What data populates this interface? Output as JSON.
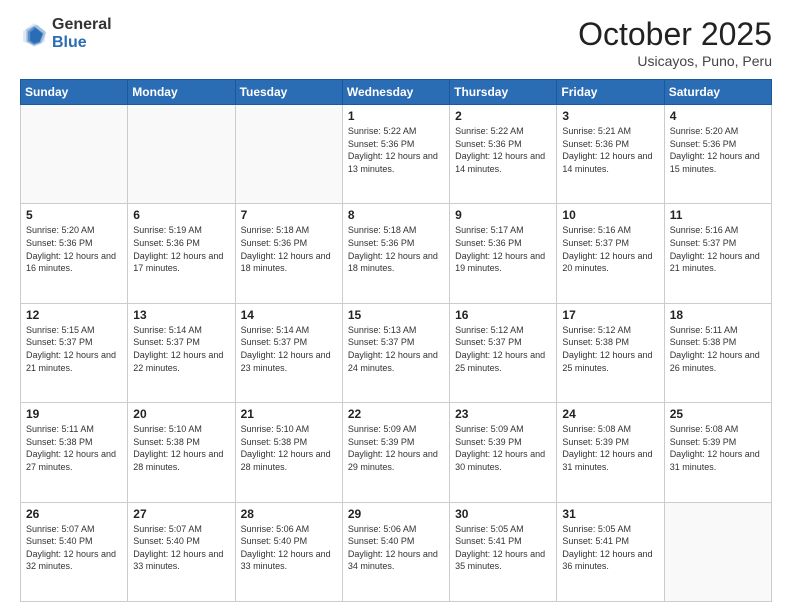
{
  "header": {
    "logo_general": "General",
    "logo_blue": "Blue",
    "title": "October 2025",
    "location": "Usicayos, Puno, Peru"
  },
  "calendar": {
    "days_of_week": [
      "Sunday",
      "Monday",
      "Tuesday",
      "Wednesday",
      "Thursday",
      "Friday",
      "Saturday"
    ],
    "weeks": [
      [
        {
          "day": "",
          "info": ""
        },
        {
          "day": "",
          "info": ""
        },
        {
          "day": "",
          "info": ""
        },
        {
          "day": "1",
          "info": "Sunrise: 5:22 AM\nSunset: 5:36 PM\nDaylight: 12 hours and 13 minutes."
        },
        {
          "day": "2",
          "info": "Sunrise: 5:22 AM\nSunset: 5:36 PM\nDaylight: 12 hours and 14 minutes."
        },
        {
          "day": "3",
          "info": "Sunrise: 5:21 AM\nSunset: 5:36 PM\nDaylight: 12 hours and 14 minutes."
        },
        {
          "day": "4",
          "info": "Sunrise: 5:20 AM\nSunset: 5:36 PM\nDaylight: 12 hours and 15 minutes."
        }
      ],
      [
        {
          "day": "5",
          "info": "Sunrise: 5:20 AM\nSunset: 5:36 PM\nDaylight: 12 hours and 16 minutes."
        },
        {
          "day": "6",
          "info": "Sunrise: 5:19 AM\nSunset: 5:36 PM\nDaylight: 12 hours and 17 minutes."
        },
        {
          "day": "7",
          "info": "Sunrise: 5:18 AM\nSunset: 5:36 PM\nDaylight: 12 hours and 18 minutes."
        },
        {
          "day": "8",
          "info": "Sunrise: 5:18 AM\nSunset: 5:36 PM\nDaylight: 12 hours and 18 minutes."
        },
        {
          "day": "9",
          "info": "Sunrise: 5:17 AM\nSunset: 5:36 PM\nDaylight: 12 hours and 19 minutes."
        },
        {
          "day": "10",
          "info": "Sunrise: 5:16 AM\nSunset: 5:37 PM\nDaylight: 12 hours and 20 minutes."
        },
        {
          "day": "11",
          "info": "Sunrise: 5:16 AM\nSunset: 5:37 PM\nDaylight: 12 hours and 21 minutes."
        }
      ],
      [
        {
          "day": "12",
          "info": "Sunrise: 5:15 AM\nSunset: 5:37 PM\nDaylight: 12 hours and 21 minutes."
        },
        {
          "day": "13",
          "info": "Sunrise: 5:14 AM\nSunset: 5:37 PM\nDaylight: 12 hours and 22 minutes."
        },
        {
          "day": "14",
          "info": "Sunrise: 5:14 AM\nSunset: 5:37 PM\nDaylight: 12 hours and 23 minutes."
        },
        {
          "day": "15",
          "info": "Sunrise: 5:13 AM\nSunset: 5:37 PM\nDaylight: 12 hours and 24 minutes."
        },
        {
          "day": "16",
          "info": "Sunrise: 5:12 AM\nSunset: 5:37 PM\nDaylight: 12 hours and 25 minutes."
        },
        {
          "day": "17",
          "info": "Sunrise: 5:12 AM\nSunset: 5:38 PM\nDaylight: 12 hours and 25 minutes."
        },
        {
          "day": "18",
          "info": "Sunrise: 5:11 AM\nSunset: 5:38 PM\nDaylight: 12 hours and 26 minutes."
        }
      ],
      [
        {
          "day": "19",
          "info": "Sunrise: 5:11 AM\nSunset: 5:38 PM\nDaylight: 12 hours and 27 minutes."
        },
        {
          "day": "20",
          "info": "Sunrise: 5:10 AM\nSunset: 5:38 PM\nDaylight: 12 hours and 28 minutes."
        },
        {
          "day": "21",
          "info": "Sunrise: 5:10 AM\nSunset: 5:38 PM\nDaylight: 12 hours and 28 minutes."
        },
        {
          "day": "22",
          "info": "Sunrise: 5:09 AM\nSunset: 5:39 PM\nDaylight: 12 hours and 29 minutes."
        },
        {
          "day": "23",
          "info": "Sunrise: 5:09 AM\nSunset: 5:39 PM\nDaylight: 12 hours and 30 minutes."
        },
        {
          "day": "24",
          "info": "Sunrise: 5:08 AM\nSunset: 5:39 PM\nDaylight: 12 hours and 31 minutes."
        },
        {
          "day": "25",
          "info": "Sunrise: 5:08 AM\nSunset: 5:39 PM\nDaylight: 12 hours and 31 minutes."
        }
      ],
      [
        {
          "day": "26",
          "info": "Sunrise: 5:07 AM\nSunset: 5:40 PM\nDaylight: 12 hours and 32 minutes."
        },
        {
          "day": "27",
          "info": "Sunrise: 5:07 AM\nSunset: 5:40 PM\nDaylight: 12 hours and 33 minutes."
        },
        {
          "day": "28",
          "info": "Sunrise: 5:06 AM\nSunset: 5:40 PM\nDaylight: 12 hours and 33 minutes."
        },
        {
          "day": "29",
          "info": "Sunrise: 5:06 AM\nSunset: 5:40 PM\nDaylight: 12 hours and 34 minutes."
        },
        {
          "day": "30",
          "info": "Sunrise: 5:05 AM\nSunset: 5:41 PM\nDaylight: 12 hours and 35 minutes."
        },
        {
          "day": "31",
          "info": "Sunrise: 5:05 AM\nSunset: 5:41 PM\nDaylight: 12 hours and 36 minutes."
        },
        {
          "day": "",
          "info": ""
        }
      ]
    ]
  }
}
